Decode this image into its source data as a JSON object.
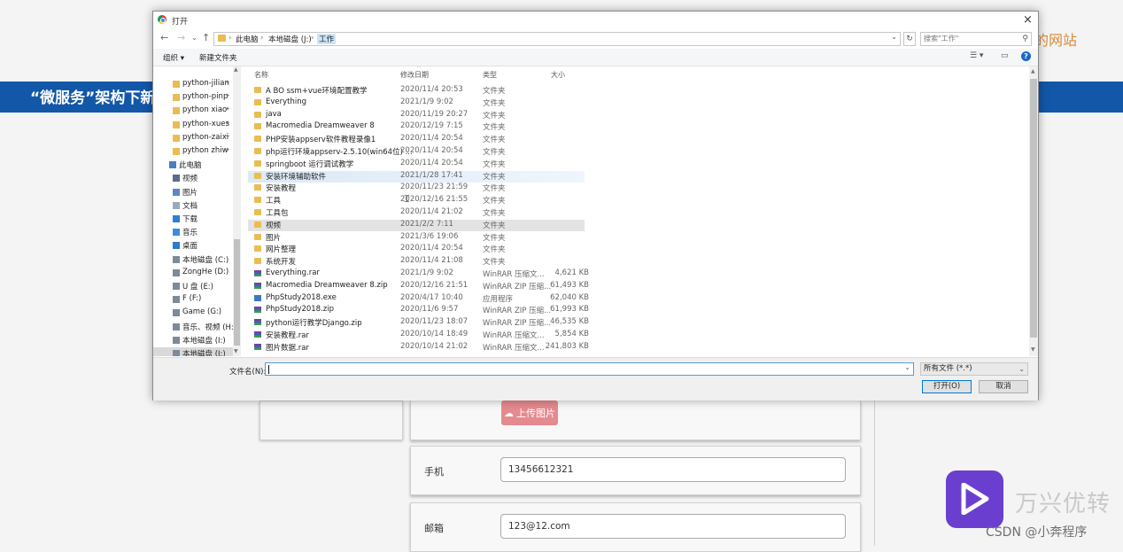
{
  "background": {
    "title_right": "的网站",
    "banner_text": "“微服务”架构下新",
    "upload_button": "上传图片",
    "phone_label": "手机",
    "phone_value": "13456612321",
    "email_label": "邮箱",
    "email_value": "123@12.com",
    "watermark_brand": "万兴优转",
    "watermark_csdn": "CSDN @小奔程序"
  },
  "dialog": {
    "title": "打开",
    "close": "×",
    "breadcrumb": [
      "此电脑",
      "本地磁盘 (J:)",
      "工作"
    ],
    "search_placeholder": "搜索\"工作\"",
    "toolbar": {
      "organize": "组织 ▾",
      "new_folder": "新建文件夹",
      "help": "?"
    },
    "nav_items": [
      {
        "label": "python-jilian",
        "icon": "folder-icon",
        "pinned": true
      },
      {
        "label": "python-pinp",
        "icon": "folder-icon",
        "pinned": true
      },
      {
        "label": "python xiao",
        "icon": "folder-icon",
        "pinned": true
      },
      {
        "label": "python-xues",
        "icon": "folder-icon",
        "pinned": true
      },
      {
        "label": "python-zaixi",
        "icon": "folder-icon",
        "pinned": true
      },
      {
        "label": "python zhiw",
        "icon": "folder-icon",
        "pinned": true
      },
      {
        "label": "此电脑",
        "icon": "computer-icon",
        "pinned": false
      },
      {
        "label": "视频",
        "icon": "video-icon",
        "pinned": false
      },
      {
        "label": "图片",
        "icon": "pictures-icon",
        "pinned": false
      },
      {
        "label": "文档",
        "icon": "documents-icon",
        "pinned": false
      },
      {
        "label": "下载",
        "icon": "download-icon",
        "pinned": false
      },
      {
        "label": "音乐",
        "icon": "music-icon",
        "pinned": false
      },
      {
        "label": "桌面",
        "icon": "desktop-icon",
        "pinned": false
      },
      {
        "label": "本地磁盘 (C:)",
        "icon": "drive-icon",
        "pinned": false
      },
      {
        "label": "ZongHe (D:)",
        "icon": "drive-icon",
        "pinned": false
      },
      {
        "label": "U 盘 (E:)",
        "icon": "drive-icon",
        "pinned": false
      },
      {
        "label": "F (F:)",
        "icon": "drive-icon",
        "pinned": false
      },
      {
        "label": "Game (G:)",
        "icon": "drive-icon",
        "pinned": false
      },
      {
        "label": "音乐、视频 (H:)",
        "icon": "drive-icon",
        "pinned": false
      },
      {
        "label": "本地磁盘 (I:)",
        "icon": "drive-icon",
        "pinned": false
      },
      {
        "label": "本地磁盘 (J:)",
        "icon": "drive-icon",
        "pinned": false,
        "selected": true
      }
    ],
    "columns": {
      "name": "名称",
      "date": "修改日期",
      "type": "类型",
      "size": "大小"
    },
    "files": [
      {
        "name": "A BO ssm+vue环境配置教学",
        "date": "2020/11/4 20:53",
        "type": "文件夹",
        "size": "",
        "icon": "folder"
      },
      {
        "name": "Everything",
        "date": "2021/1/9 9:02",
        "type": "文件夹",
        "size": "",
        "icon": "folder"
      },
      {
        "name": "java",
        "date": "2020/11/19 20:27",
        "type": "文件夹",
        "size": "",
        "icon": "folder"
      },
      {
        "name": "Macromedia Dreamweaver 8",
        "date": "2020/12/19 7:15",
        "type": "文件夹",
        "size": "",
        "icon": "folder"
      },
      {
        "name": "PHP安装appserv软件教程录像1",
        "date": "2020/11/4 20:54",
        "type": "文件夹",
        "size": "",
        "icon": "folder"
      },
      {
        "name": "php运行环境appserv-2.5.10(win64位) ...",
        "date": "2020/11/4 20:54",
        "type": "文件夹",
        "size": "",
        "icon": "folder"
      },
      {
        "name": "springboot 运行调试教学",
        "date": "2020/11/4 20:54",
        "type": "文件夹",
        "size": "",
        "icon": "folder"
      },
      {
        "name": "安装环境辅助软件",
        "date": "2021/1/28 17:41",
        "type": "文件夹",
        "size": "",
        "icon": "folder",
        "highlight": "hover"
      },
      {
        "name": "安装教程",
        "date": "2020/11/23 21:59",
        "type": "文件夹",
        "size": "",
        "icon": "folder"
      },
      {
        "name": "工具",
        "date": "2020/12/16 21:55",
        "type": "文件夹",
        "size": "",
        "icon": "folder"
      },
      {
        "name": "工具包",
        "date": "2020/11/4 21:02",
        "type": "文件夹",
        "size": "",
        "icon": "folder"
      },
      {
        "name": "视频",
        "date": "2021/2/2 7:11",
        "type": "文件夹",
        "size": "",
        "icon": "folder",
        "highlight": "selected"
      },
      {
        "name": "图片",
        "date": "2021/3/6 19:06",
        "type": "文件夹",
        "size": "",
        "icon": "folder"
      },
      {
        "name": "网片整理",
        "date": "2020/11/4 20:54",
        "type": "文件夹",
        "size": "",
        "icon": "folder"
      },
      {
        "name": "系统开发",
        "date": "2020/11/4 21:08",
        "type": "文件夹",
        "size": "",
        "icon": "folder"
      },
      {
        "name": "Everything.rar",
        "date": "2021/1/9 9:02",
        "type": "WinRAR 压缩文...",
        "size": "4,621 KB",
        "icon": "rar"
      },
      {
        "name": "Macromedia Dreamweaver 8.zip",
        "date": "2020/12/16 21:51",
        "type": "WinRAR ZIP 压缩...",
        "size": "61,493 KB",
        "icon": "rar"
      },
      {
        "name": "PhpStudy2018.exe",
        "date": "2020/4/17 10:40",
        "type": "应用程序",
        "size": "62,040 KB",
        "icon": "exe"
      },
      {
        "name": "PhpStudy2018.zip",
        "date": "2020/11/6 9:57",
        "type": "WinRAR ZIP 压缩...",
        "size": "61,993 KB",
        "icon": "rar"
      },
      {
        "name": "python运行教学Django.zip",
        "date": "2020/11/23 18:07",
        "type": "WinRAR ZIP 压缩...",
        "size": "46,535 KB",
        "icon": "rar"
      },
      {
        "name": "安装教程.rar",
        "date": "2020/10/14 18:49",
        "type": "WinRAR 压缩文...",
        "size": "5,854 KB",
        "icon": "rar"
      },
      {
        "name": "图片数据.rar",
        "date": "2020/10/14 21:02",
        "type": "WinRAR 压缩文...",
        "size": "241,803 KB",
        "icon": "rar"
      }
    ],
    "filename_label": "文件名(N):",
    "filename_value": "",
    "filetype_value": "所有文件 (*.*)",
    "open_button": "打开(O)",
    "cancel_button": "取消"
  }
}
